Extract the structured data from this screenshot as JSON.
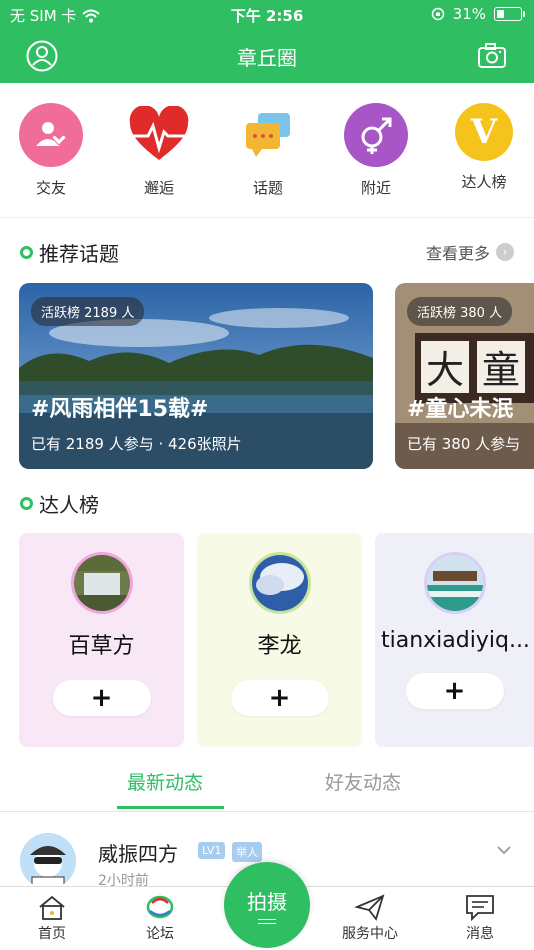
{
  "status_bar": {
    "carrier": "无 SIM 卡",
    "time": "下午 2:56",
    "battery": "31%"
  },
  "navbar": {
    "title": "章丘圈"
  },
  "quick_actions": [
    {
      "label": "交友",
      "icon": "friends-icon",
      "color": "#f06d9b"
    },
    {
      "label": "邂逅",
      "icon": "heartbeat-icon",
      "color": "#e02b2b"
    },
    {
      "label": "话题",
      "icon": "topic-chat-icon",
      "color": "#f2b632"
    },
    {
      "label": "附近",
      "icon": "gender-icon",
      "color": "#a855c6"
    },
    {
      "label": "达人榜",
      "icon": "v-badge-icon",
      "color": "#f6c21c"
    }
  ],
  "recommended": {
    "title": "推荐话题",
    "more": "查看更多",
    "topics": [
      {
        "badge": "活跃榜 2189 人",
        "title": "#风雨相伴15载#",
        "sub": "已有 2189 人参与 · 426张照片"
      },
      {
        "badge": "活跃榜 380 人",
        "title": "#童心未泯",
        "sub": "已有 380 人参与"
      }
    ]
  },
  "experts": {
    "title": "达人榜",
    "add_label": "+",
    "cards": [
      {
        "name": "百草方",
        "bg": "#f8e8f6",
        "ring": "#f2a6df"
      },
      {
        "name": "李龙",
        "bg": "#f7fbe6",
        "ring": "#c8e49a"
      },
      {
        "name": "tianxiadiyiq...",
        "bg": "#efeff8",
        "ring": "#d8d0f4"
      }
    ]
  },
  "feed_tabs": {
    "active": "最新动态",
    "inactive": "好友动态"
  },
  "post": {
    "name": "威振四方",
    "level": "LV1",
    "role": "举人",
    "time": "2小时前"
  },
  "bottom_nav": {
    "home": "首页",
    "forum": "论坛",
    "shoot": "拍摄",
    "service": "服务中心",
    "messages": "消息"
  },
  "colors": {
    "brand": "#2fbf62"
  }
}
